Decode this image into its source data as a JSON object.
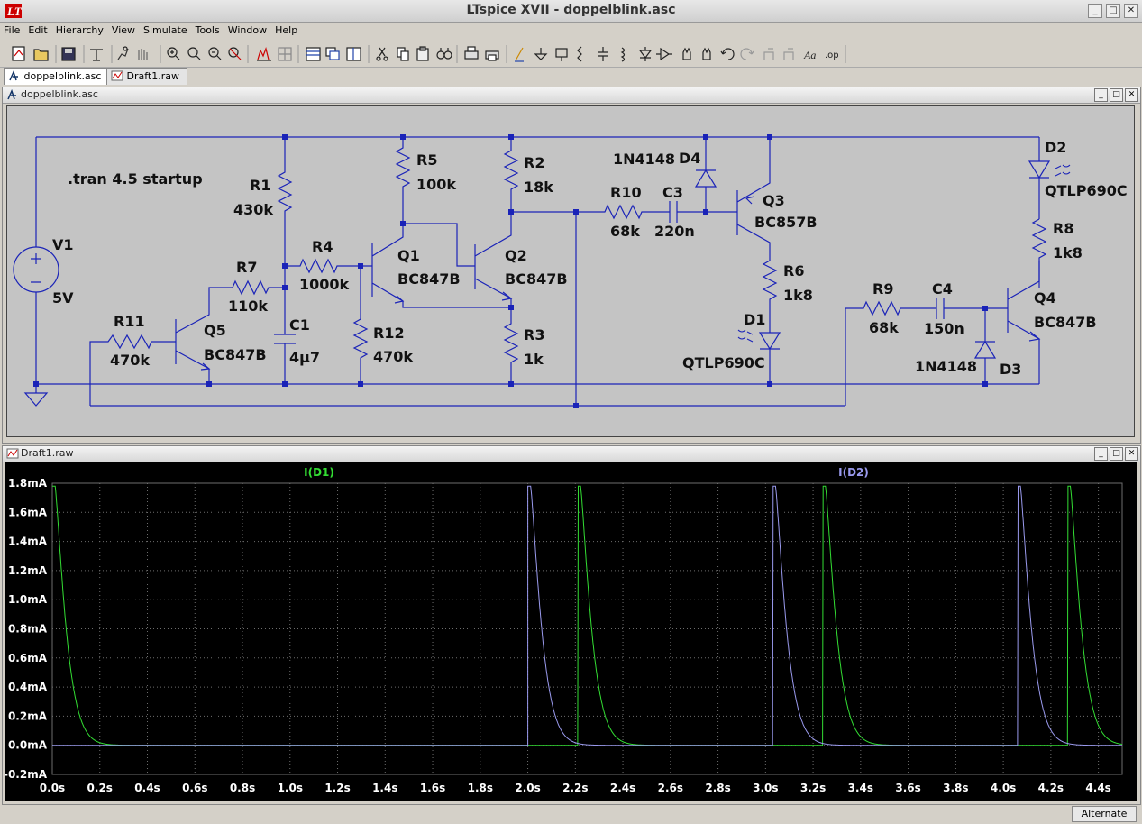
{
  "app": {
    "title": "LTspice XVII - doppelblink.asc",
    "menu": [
      "File",
      "Edit",
      "Hierarchy",
      "View",
      "Simulate",
      "Tools",
      "Window",
      "Help"
    ],
    "tabs": [
      {
        "label": "doppelblink.asc"
      },
      {
        "label": "Draft1.raw"
      }
    ],
    "status": "Alternate",
    "window_buttons": [
      "_",
      "□",
      "✕"
    ]
  },
  "schematic": {
    "title": "doppelblink.asc",
    "directive": ".tran 4.5 startup",
    "components": [
      {
        "ref": "V1",
        "value": "5V"
      },
      {
        "ref": "R1",
        "value": "430k"
      },
      {
        "ref": "R2",
        "value": "18k"
      },
      {
        "ref": "R3",
        "value": "1k"
      },
      {
        "ref": "R4",
        "value": "1000k"
      },
      {
        "ref": "R5",
        "value": "100k"
      },
      {
        "ref": "R6",
        "value": "1k8"
      },
      {
        "ref": "R7",
        "value": "110k"
      },
      {
        "ref": "R8",
        "value": "1k8"
      },
      {
        "ref": "R9",
        "value": "68k"
      },
      {
        "ref": "R10",
        "value": "68k"
      },
      {
        "ref": "R11",
        "value": "470k"
      },
      {
        "ref": "R12",
        "value": "470k"
      },
      {
        "ref": "C1",
        "value": "4µ7"
      },
      {
        "ref": "C3",
        "value": "220n"
      },
      {
        "ref": "C4",
        "value": "150n"
      },
      {
        "ref": "Q1",
        "value": "BC847B"
      },
      {
        "ref": "Q2",
        "value": "BC847B"
      },
      {
        "ref": "Q3",
        "value": "BC857B"
      },
      {
        "ref": "Q4",
        "value": "BC847B"
      },
      {
        "ref": "Q5",
        "value": "BC847B"
      },
      {
        "ref": "D1",
        "value": "QTLP690C"
      },
      {
        "ref": "D2",
        "value": "QTLP690C"
      },
      {
        "ref": "D3",
        "value": "1N4148"
      },
      {
        "ref": "D4",
        "value": "1N4148"
      }
    ]
  },
  "waveform": {
    "title": "Draft1.raw",
    "colors": {
      "background": "#000000",
      "grid": "#6e6e6e",
      "trace_d1": "#33dd33",
      "trace_d2": "#9a9aee",
      "axis_text": "#000000"
    },
    "chart_data": {
      "type": "line",
      "xlim": [
        0,
        4.5
      ],
      "ylim": [
        -0.2,
        1.8
      ],
      "x_ticks": [
        "0.0s",
        "0.2s",
        "0.4s",
        "0.6s",
        "0.8s",
        "1.0s",
        "1.2s",
        "1.4s",
        "1.6s",
        "1.8s",
        "2.0s",
        "2.2s",
        "2.4s",
        "2.6s",
        "2.8s",
        "3.0s",
        "3.2s",
        "3.4s",
        "3.6s",
        "3.8s",
        "4.0s",
        "4.2s",
        "4.4s"
      ],
      "y_ticks": [
        "1.8mA",
        "1.6mA",
        "1.4mA",
        "1.2mA",
        "1.0mA",
        "0.8mA",
        "0.6mA",
        "0.4mA",
        "0.2mA",
        "0.0mA",
        "-0.2mA"
      ],
      "series": [
        {
          "name": "I(D1)",
          "peak_ma": 1.78,
          "tau_s": 0.03,
          "pulse_starts_s": [
            0.0,
            2.21,
            3.24,
            4.27
          ]
        },
        {
          "name": "I(D2)",
          "peak_ma": 1.78,
          "tau_s": 0.03,
          "pulse_starts_s": [
            2.0,
            3.03,
            4.06
          ]
        }
      ],
      "grid": true
    }
  }
}
